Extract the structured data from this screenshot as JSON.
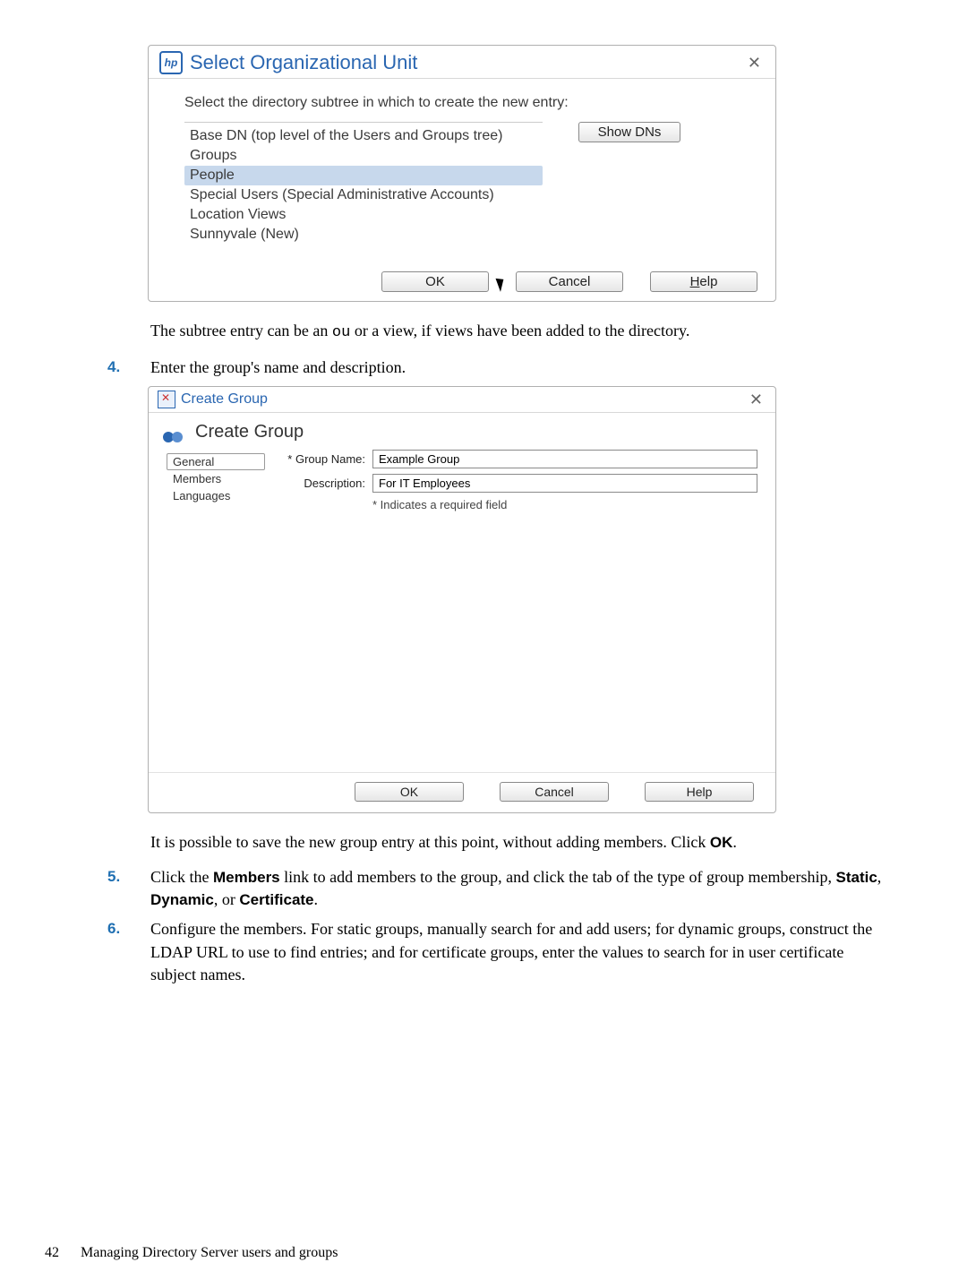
{
  "dialog1": {
    "title": "Select Organizational Unit",
    "hp_label": "hp",
    "instruction": "Select the directory subtree in which to create the new entry:",
    "items": {
      "base_dn": "Base DN (top level of the Users and Groups tree)",
      "groups": "Groups",
      "people": "People",
      "special": "Special Users (Special Administrative Accounts)",
      "loc_views": "Location Views",
      "sunnyvale": "Sunnyvale (New)"
    },
    "show_dns": "Show DNs",
    "ok": "OK",
    "cancel": "Cancel",
    "help": "Help"
  },
  "para_after_d1_a": "The subtree entry can be an ",
  "para_after_d1_code": "ou",
  "para_after_d1_b": " or a view, if views have been added to the directory.",
  "step4": "Enter the group's name and description.",
  "dialog2": {
    "window_title": "Create Group",
    "header": "Create Group",
    "tabs": {
      "general": "General",
      "members": "Members",
      "languages": "Languages"
    },
    "labels": {
      "group_name": "* Group Name:",
      "description": "Description:"
    },
    "values": {
      "group_name": "Example Group",
      "description": "For IT Employees"
    },
    "note": "* Indicates a required field",
    "ok": "OK",
    "cancel": "Cancel",
    "help": "Help"
  },
  "para_after_d2": "It is possible to save the new group entry at this point, without adding members. Click ",
  "para_after_d2_ok": "OK",
  "para_after_d2_end": ".",
  "step5_a": "Click the ",
  "step5_members": "Members",
  "step5_b": " link to add members to the group, and click the tab of the type of group membership, ",
  "step5_static": "Static",
  "step5_dyn": "Dynamic",
  "step5_or": ", or ",
  "step5_cert": "Certificate",
  "step5_end": ".",
  "step6": "Configure the members. For static groups, manually search for and add users; for dynamic groups, construct the LDAP URL to use to find entries; and for certificate groups, enter the values to search for in user certificate subject names.",
  "footer_page": "42",
  "footer_text": "Managing Directory Server users and groups"
}
